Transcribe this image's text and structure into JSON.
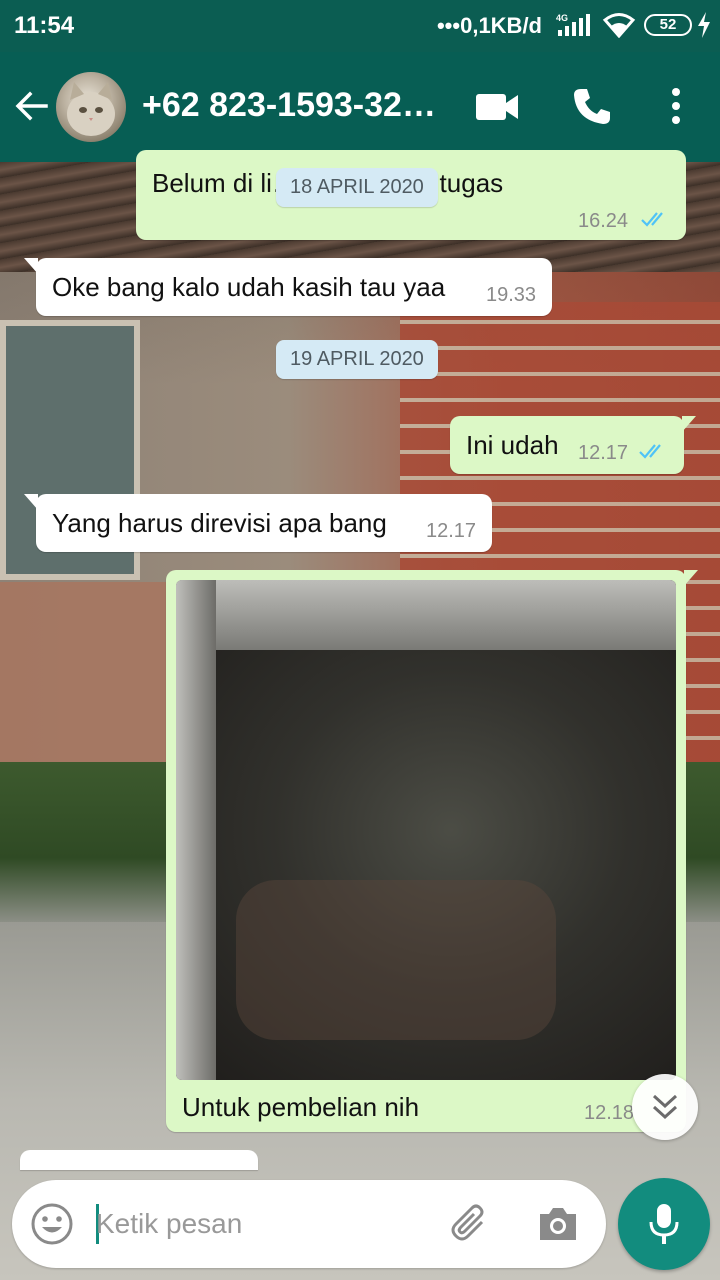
{
  "status_bar": {
    "time": "11:54",
    "network_speed": "•••0,1KB/d",
    "network_type": "4G",
    "battery": "52"
  },
  "header": {
    "contact_name": "+62 823-1593-32…"
  },
  "messages": [
    {
      "direction": "out",
      "text": "Belum di li…, masih ada tugas",
      "time": "16.24",
      "status": "read"
    },
    {
      "direction": "date",
      "text": "18 APRIL 2020"
    },
    {
      "direction": "in",
      "text": "Oke bang kalo udah kasih tau yaa",
      "time": "19.33"
    },
    {
      "direction": "date",
      "text": "19 APRIL 2020"
    },
    {
      "direction": "out",
      "text": "Ini udah",
      "time": "12.17",
      "status": "read"
    },
    {
      "direction": "in",
      "text": "Yang harus direvisi apa bang",
      "time": "12.17"
    },
    {
      "direction": "out",
      "type": "image",
      "caption": "Untuk pembelian nih",
      "time": "12.18"
    }
  ],
  "composer": {
    "placeholder": "Ketik pesan"
  },
  "colors": {
    "header": "#075e54",
    "status_bar": "#0b5d52",
    "outgoing_bubble": "#dcf8c6",
    "incoming_bubble": "#ffffff",
    "accent": "#128c7e",
    "read_ticks": "#4fc3f7",
    "date_chip": "#d5eaf5"
  },
  "icons": [
    "back-arrow-icon",
    "video-call-icon",
    "phone-icon",
    "more-vert-icon",
    "emoji-icon",
    "attach-icon",
    "camera-icon",
    "mic-icon",
    "double-chevron-down-icon",
    "double-check-icon"
  ]
}
